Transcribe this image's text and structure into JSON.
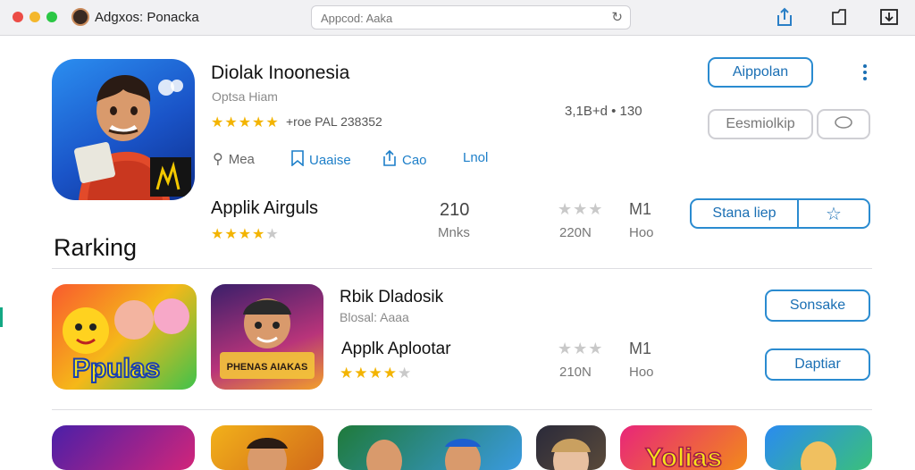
{
  "window": {
    "title": "Adgxos: Ponacka",
    "search": {
      "placeholder": "Appcod: Aaka"
    }
  },
  "featured": {
    "title": "Diolak Inoonesia",
    "subtitle": "Optsa Hiam",
    "rating_text": "+roe PAL 238352",
    "stat": "3,1B+d • 130",
    "actions": [
      {
        "label": "Mea",
        "icon": "search-icon"
      },
      {
        "label": "Uaaise",
        "icon": "bookmark-icon"
      },
      {
        "label": "Cao",
        "icon": "share-icon"
      },
      {
        "label": "Lnol",
        "icon": "link-icon"
      }
    ],
    "primary_button": "Aippolan",
    "secondary_button": "Eesmiolkip"
  },
  "featured_row": {
    "title": "Applik Airguls",
    "count": "210",
    "count_label": "Mnks",
    "rating_value": "M1",
    "rating_count": "220N",
    "rating_label": "Hoo",
    "button": "Stana liep"
  },
  "section": {
    "heading": "Rarking"
  },
  "ranked": [
    {
      "title": "Rbik Dladosik",
      "subtitle": "Blosal: Aaaa",
      "button": "Sonsake",
      "icons": [
        {
          "name": "ppulas-app-icon",
          "label": "Ppulas"
        },
        {
          "name": "phenas-app-icon",
          "label": "PHENAS AIAKAS"
        }
      ]
    },
    {
      "title": "Applk Aplootar",
      "rating_value": "M1",
      "rating_count": "210N",
      "rating_label": "Hoo",
      "button": "Daptiar"
    }
  ],
  "bottom_icons": [
    {
      "name": "bottom-app-icon-1"
    },
    {
      "name": "bottom-app-icon-2"
    },
    {
      "name": "bottom-app-icon-3"
    },
    {
      "name": "bottom-app-icon-4"
    },
    {
      "name": "bottom-app-icon-5",
      "label": "Yolias"
    },
    {
      "name": "bottom-app-icon-6"
    }
  ],
  "colors": {
    "accent": "#1d7fc9",
    "star": "#f3b400",
    "titlebar": "#f1f1f3"
  }
}
